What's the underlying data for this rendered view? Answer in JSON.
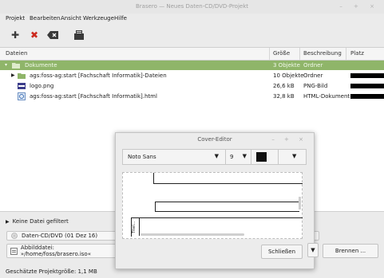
{
  "window": {
    "title": "Brasero — Neues Daten-CD/DVD-Projekt",
    "controls": "– + ×"
  },
  "menu": [
    "Projekt",
    "Bearbeiten",
    "Ansicht",
    "Werkzeuge",
    "Hilfe"
  ],
  "toolbar": {
    "icons": [
      "add-icon",
      "remove-icon",
      "clear-icon",
      "import-session-icon"
    ]
  },
  "table": {
    "headers": [
      "Dateien",
      "Größe",
      "Beschreibung",
      "Platz"
    ],
    "rows": [
      {
        "name": "Dokumente",
        "size": "3 Objekte",
        "desc": "Ordner",
        "selected": true,
        "icon": "folder-icon"
      },
      {
        "name": "ags:foss-ag:start [Fachschaft Informatik]-Dateien",
        "size": "10 Objekte",
        "desc": "Ordner",
        "selected": false,
        "icon": "folder-icon"
      },
      {
        "name": "logo.png",
        "size": "26,6 kB",
        "desc": "PNG-Bild",
        "selected": false,
        "icon": "image-icon"
      },
      {
        "name": "ags:foss-ag:start [Fachschaft Informatik].html",
        "size": "32,8 kB",
        "desc": "HTML-Dokument",
        "selected": false,
        "icon": "html-icon"
      }
    ]
  },
  "bottom": {
    "filter_label": "Keine Datei gefiltert",
    "disc_label": "Daten-CD/DVD (01 Dez 16)",
    "image_file_label": "Abbilddatei: »/home/foss/brasero.iso«",
    "burn_label": "Brennen ...",
    "estimated_size": "Geschätzte Projektgröße: 1,1 MB"
  },
  "cover_editor": {
    "title": "Cover-Editor",
    "controls": "– + ×",
    "font": "Noto Sans",
    "font_size": "9",
    "text_color": "#111111",
    "close_label": "Schließen",
    "side_text": "Titel..."
  },
  "colors": {
    "selection": "#8fb569",
    "accent_red": "#cc2a1f"
  }
}
